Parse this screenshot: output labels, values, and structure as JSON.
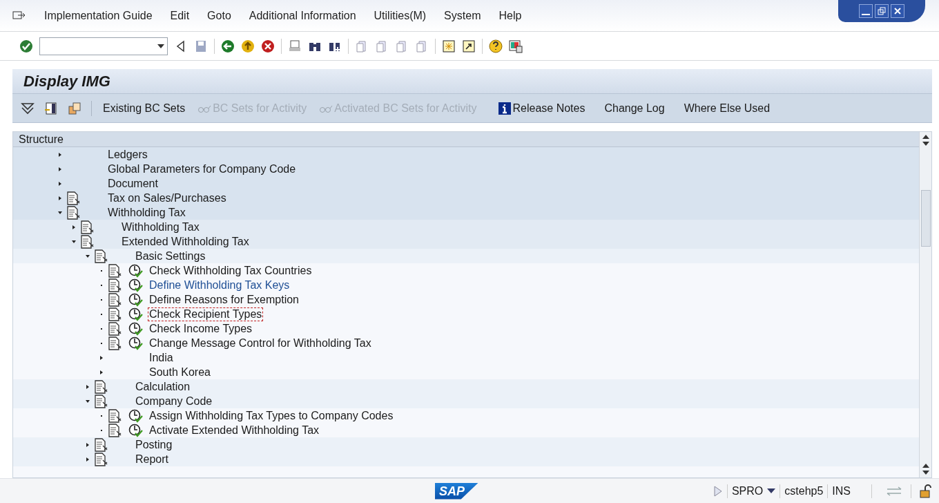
{
  "menu": [
    {
      "label": "Implementation Guide"
    },
    {
      "label": "Edit"
    },
    {
      "label": "Goto"
    },
    {
      "label": "Additional Information"
    },
    {
      "label": "Utilities(M)"
    },
    {
      "label": "System"
    },
    {
      "label": "Help"
    }
  ],
  "title": "Display IMG",
  "app_toolbar": [
    {
      "kind": "text",
      "label": "Existing BC Sets",
      "disabled": false
    },
    {
      "kind": "glasses",
      "label": "BC Sets for Activity",
      "disabled": true
    },
    {
      "kind": "glasses",
      "label": "Activated BC Sets for Activity",
      "disabled": true
    },
    {
      "kind": "info",
      "label": "Release Notes",
      "disabled": false
    },
    {
      "kind": "text",
      "label": "Change Log",
      "disabled": false
    },
    {
      "kind": "text",
      "label": "Where Else Used",
      "disabled": false
    }
  ],
  "tree": {
    "header": "Structure",
    "nodes": [
      {
        "kind": "folder",
        "label": "Ledgers",
        "expanded": false,
        "documented": false
      },
      {
        "kind": "folder",
        "label": "Global Parameters for Company Code",
        "expanded": false,
        "documented": false
      },
      {
        "kind": "folder",
        "label": "Document",
        "expanded": false,
        "documented": false
      },
      {
        "kind": "folder",
        "label": "Tax on Sales/Purchases",
        "expanded": false,
        "documented": true
      },
      {
        "kind": "folder",
        "label": "Withholding Tax",
        "expanded": true,
        "documented": true,
        "children": [
          {
            "kind": "folder",
            "label": "Withholding Tax",
            "expanded": false,
            "documented": true
          },
          {
            "kind": "folder",
            "label": "Extended Withholding Tax",
            "expanded": true,
            "documented": true,
            "children": [
              {
                "kind": "folder",
                "label": "Basic Settings",
                "expanded": true,
                "documented": true,
                "children": [
                  {
                    "kind": "activity",
                    "label": "Check Withholding Tax Countries",
                    "documented": true,
                    "highlighted": false,
                    "focused": false
                  },
                  {
                    "kind": "activity",
                    "label": "Define Withholding Tax Keys",
                    "documented": true,
                    "highlighted": true,
                    "focused": false
                  },
                  {
                    "kind": "activity",
                    "label": "Define Reasons for Exemption",
                    "documented": true,
                    "highlighted": false,
                    "focused": false
                  },
                  {
                    "kind": "activity",
                    "label": "Check Recipient Types",
                    "documented": true,
                    "highlighted": false,
                    "focused": true
                  },
                  {
                    "kind": "activity",
                    "label": "Check Income Types",
                    "documented": true,
                    "highlighted": false,
                    "focused": false
                  },
                  {
                    "kind": "activity",
                    "label": "Change Message Control for Withholding Tax",
                    "documented": true,
                    "highlighted": false,
                    "focused": false
                  },
                  {
                    "kind": "folder",
                    "label": "India",
                    "expanded": false,
                    "documented": false
                  },
                  {
                    "kind": "folder",
                    "label": "South Korea",
                    "expanded": false,
                    "documented": false
                  }
                ]
              },
              {
                "kind": "folder",
                "label": "Calculation",
                "expanded": false,
                "documented": true
              },
              {
                "kind": "folder",
                "label": "Company Code",
                "expanded": true,
                "documented": true,
                "children": [
                  {
                    "kind": "activity",
                    "label": "Assign Withholding Tax Types to Company Codes",
                    "documented": true,
                    "highlighted": false,
                    "focused": false
                  },
                  {
                    "kind": "activity",
                    "label": "Activate Extended Withholding Tax",
                    "documented": true,
                    "highlighted": false,
                    "focused": false
                  }
                ]
              },
              {
                "kind": "folder",
                "label": "Posting",
                "expanded": false,
                "documented": true
              },
              {
                "kind": "folder",
                "label": "Report",
                "expanded": false,
                "documented": true
              }
            ]
          }
        ]
      }
    ]
  },
  "status_bar": {
    "logo": "SAP",
    "transaction": "SPRO",
    "server": "cstehp5",
    "mode": "INS"
  }
}
